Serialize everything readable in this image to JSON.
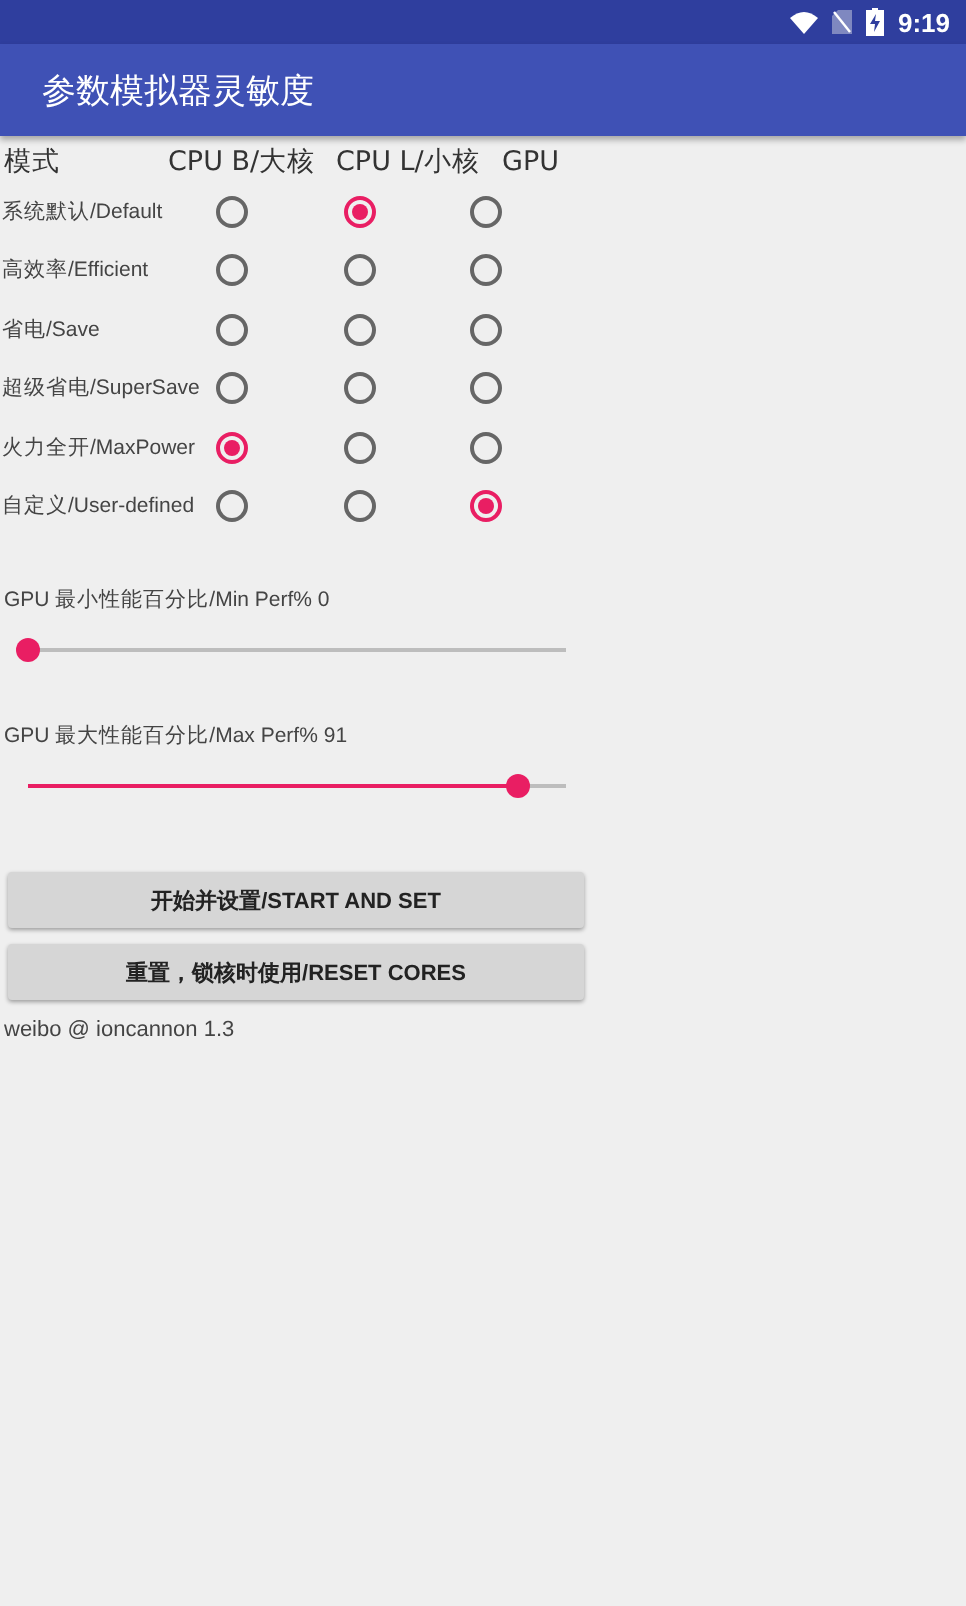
{
  "status_bar": {
    "time": "9:19"
  },
  "app_bar": {
    "title": "参数模拟器灵敏度"
  },
  "mode_table": {
    "columns": [
      "模式",
      "CPU B/大核",
      "CPU L/小核",
      "GPU"
    ],
    "rows": [
      {
        "label": "系统默认/Default",
        "options": [
          {
            "selected": false
          },
          {
            "selected": true
          },
          {
            "selected": false
          }
        ]
      },
      {
        "label": "高效率/Efficient",
        "options": [
          {
            "selected": false
          },
          {
            "selected": false
          },
          {
            "selected": false
          }
        ]
      },
      {
        "label": "省电/Save",
        "options": [
          {
            "selected": false
          },
          {
            "selected": false
          },
          {
            "selected": false
          }
        ]
      },
      {
        "label": "超级省电/SuperSave",
        "options": [
          {
            "selected": false
          },
          {
            "selected": false
          },
          {
            "selected": false
          }
        ]
      },
      {
        "label": "火力全开/MaxPower",
        "options": [
          {
            "selected": true
          },
          {
            "selected": false
          },
          {
            "selected": false
          }
        ]
      },
      {
        "label": "自定义/User-defined",
        "options": [
          {
            "selected": false
          },
          {
            "selected": false
          },
          {
            "selected": true
          }
        ]
      }
    ]
  },
  "sliders": [
    {
      "label": "GPU 最小性能百分比/Min Perf% 0",
      "level": 0
    },
    {
      "label": "GPU 最大性能百分比/Max Perf% 91",
      "level": 0.91
    }
  ],
  "buttons": [
    "开始并设置/START AND SET",
    "重置，锁核时使用/RESET CORES"
  ],
  "footer": "weibo @ ioncannon 1.3"
}
